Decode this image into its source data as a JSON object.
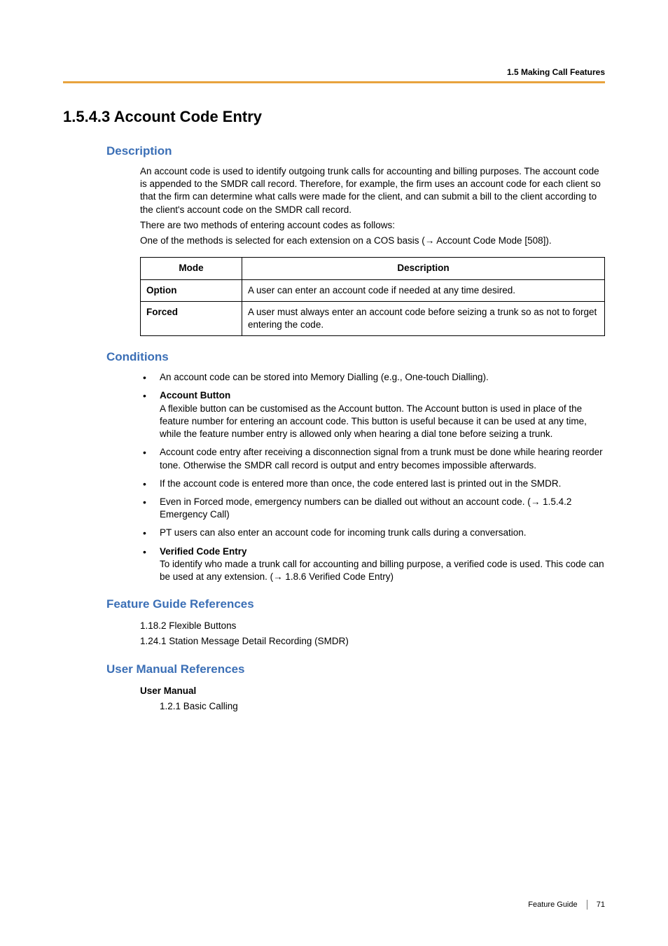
{
  "header": {
    "running": "1.5 Making Call Features"
  },
  "title": "1.5.4.3   Account Code Entry",
  "description": {
    "heading": "Description",
    "p1": "An account code is used to identify outgoing trunk calls for accounting and billing purposes. The account code is appended to the SMDR call record. Therefore, for example, the firm uses an account code for each client so that the firm can determine what calls were made for the client, and can submit a bill to the client according to the client's account code on the SMDR call record.",
    "p2": "There are two methods of entering account codes as follows:",
    "p3a": "One of the methods is selected for each extension on a COS basis (",
    "p3b": " Account Code Mode [508]).",
    "table": {
      "h1": "Mode",
      "h2": "Description",
      "rows": [
        {
          "mode": "Option",
          "desc": "A user can enter an account code if needed at any time desired."
        },
        {
          "mode": "Forced",
          "desc": "A user must always enter an account code before seizing a trunk so as not to forget entering the code."
        }
      ]
    }
  },
  "conditions": {
    "heading": "Conditions",
    "items": {
      "i0": "An account code can be stored into Memory Dialling (e.g., One-touch Dialling).",
      "i1_title": "Account Button",
      "i1_body": "A flexible button can be customised as the Account button. The Account button is used in place of the feature number for entering an account code. This button is useful because it can be used at any time, while the feature number entry is allowed only when hearing a dial tone before seizing a trunk.",
      "i2": "Account code entry after receiving a disconnection signal from a trunk must be done while hearing reorder tone. Otherwise the SMDR call record is output and entry becomes impossible afterwards.",
      "i3": "If the account code is entered more than once, the code entered last is printed out in the SMDR.",
      "i4a": "Even in Forced mode, emergency numbers can be dialled out without an account code. (",
      "i4b": " 1.5.4.2 Emergency Call)",
      "i5": "PT users can also enter an account code for incoming trunk calls during a conversation.",
      "i6_title": "Verified Code Entry",
      "i6a": "To identify who made a trunk call for accounting and billing purpose, a verified code is used. This code can be used at any extension. (",
      "i6b": " 1.8.6 Verified Code Entry)"
    }
  },
  "feature_refs": {
    "heading": "Feature Guide References",
    "r1": "1.18.2 Flexible Buttons",
    "r2": "1.24.1 Station Message Detail Recording (SMDR)"
  },
  "user_refs": {
    "heading": "User Manual References",
    "subhead": "User Manual",
    "r1": "1.2.1 Basic Calling"
  },
  "footer": {
    "label": "Feature Guide",
    "page": "71"
  },
  "glyphs": {
    "arrow": "→"
  }
}
